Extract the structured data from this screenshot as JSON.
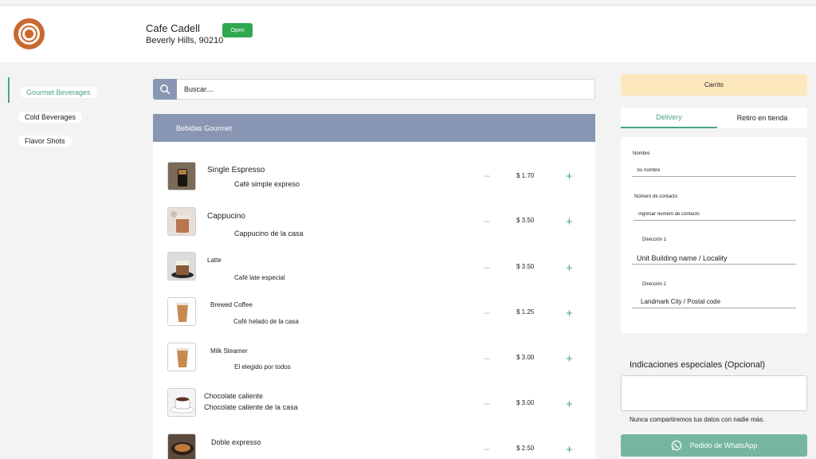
{
  "shop": {
    "name": "Cafe Cadell",
    "address": "Beverly Hills, 90210",
    "status": "Open"
  },
  "categories": [
    {
      "label": "Gourmet Beverages",
      "active": true
    },
    {
      "label": "Cold Beverages",
      "active": false
    },
    {
      "label": "Flavor Shots",
      "active": false
    }
  ],
  "search": {
    "placeholder": "Buscar...."
  },
  "menu": {
    "section_title": "Bebidas Gourmet",
    "items": [
      {
        "name": "Single Espresso",
        "description": "Café simple expreso",
        "price": "$ 1.70",
        "thumb": "espresso"
      },
      {
        "name": "Cappucino",
        "description": "Cappucino de la casa",
        "price": "$ 3.50",
        "thumb": "iced"
      },
      {
        "name": "Latte",
        "description": "Café late especial",
        "price": "$ 3.50",
        "thumb": "latte"
      },
      {
        "name": "Brewed Coffee",
        "description": "Café helado de la casa",
        "price": "$ 1.25",
        "thumb": "cup"
      },
      {
        "name": "Milk Steamer",
        "description": "El elegido por todos",
        "price": "$ 3.00",
        "thumb": "cup"
      },
      {
        "name": "Chocolate caliente",
        "description": "Chocolate caliente de la casa",
        "price": "$ 3.00",
        "thumb": "mug"
      },
      {
        "name": "Doble expresso",
        "description": "",
        "price": "$ 2.50",
        "thumb": "bowl"
      }
    ]
  },
  "cart": {
    "title": "Carrito",
    "tabs": {
      "delivery": "Delivery",
      "pickup": "Retiro en tienda"
    },
    "form": {
      "name_label": "Nombre",
      "name_placeholder": "Su nombre",
      "contact_label": "Número de contacto",
      "contact_placeholder": "Ingresar número de contacto",
      "address1_label": "Dirección 1",
      "address1_placeholder": "Unit Building name / Locality",
      "address2_label": "Dirección 2",
      "address2_placeholder": "Landmark City / Postal code"
    },
    "notes_label": "Indicaciones especiales (Opcional)",
    "privacy_note": "Nunca compartiremos tus datos con nadie más.",
    "whatsapp_button": "Pedido de WhatsApp"
  },
  "colors": {
    "accent": "#4aa387",
    "section_header": "#8896b3",
    "open_badge": "#2fa84f",
    "cart_header": "#fde8bd",
    "whatsapp_button": "#76b6a1"
  }
}
